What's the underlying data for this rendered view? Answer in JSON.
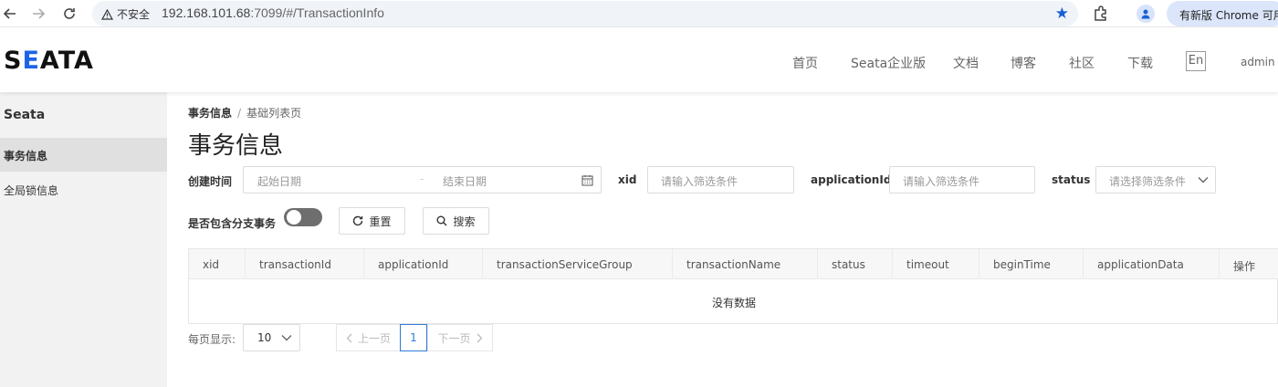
{
  "browser": {
    "security_label": "不安全",
    "url_host": "192.168.101.68",
    "url_rest": ":7099/#/TransactionInfo",
    "update_label": "有新版 Chrome 可用"
  },
  "header": {
    "logo_prefix": "S",
    "logo_blue": "E",
    "logo_rest": "ATA",
    "nav": [
      "首页",
      "Seata企业版",
      "文档",
      "博客",
      "社区",
      "下载"
    ],
    "lang": "En",
    "user": "admin"
  },
  "sidebar": {
    "title": "Seata",
    "items": [
      {
        "label": "事务信息",
        "active": true
      },
      {
        "label": "全局锁信息",
        "active": false
      }
    ]
  },
  "breadcrumb": {
    "current": "事务信息",
    "sep": "/",
    "page": "基础列表页"
  },
  "page_title": "事务信息",
  "filters": {
    "created_label": "创建时间",
    "start_placeholder": "起始日期",
    "date_sep": "-",
    "end_placeholder": "结束日期",
    "xid_label": "xid",
    "xid_placeholder": "请输入筛选条件",
    "app_label": "applicationId",
    "app_placeholder": "请输入筛选条件",
    "status_label": "status",
    "status_placeholder": "请选择筛选条件",
    "branch_label": "是否包含分支事务",
    "reset_label": "重置",
    "search_label": "搜索"
  },
  "table": {
    "columns": [
      "xid",
      "transactionId",
      "applicationId",
      "transactionServiceGroup",
      "transactionName",
      "status",
      "timeout",
      "beginTime",
      "applicationData",
      "操作"
    ],
    "empty_text": "没有数据"
  },
  "pagination": {
    "per_page_label": "每页显示:",
    "per_page_value": "10",
    "prev_label": "上一页",
    "current_page": "1",
    "next_label": "下一页"
  },
  "colors": {
    "accent": "#2f7bd9",
    "logo_blue": "#1e63e6"
  }
}
